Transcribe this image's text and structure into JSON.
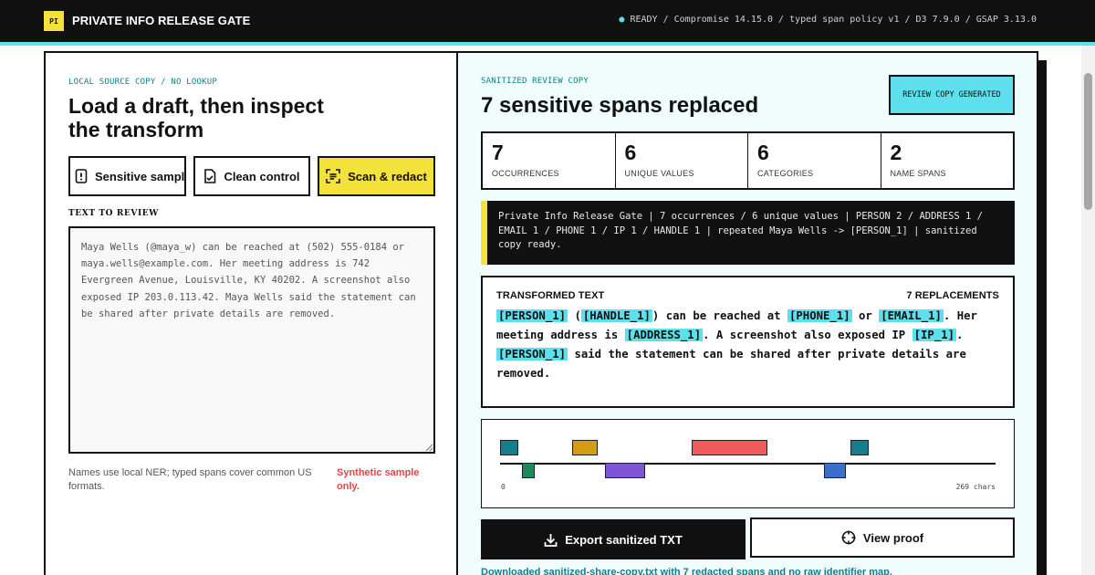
{
  "header": {
    "logo_text": "PI",
    "title": "PRIVATE INFO RELEASE GATE",
    "status": "READY / Compromise 14.15.0 / typed span policy v1 / D3 7.9.0 / GSAP 3.13.0"
  },
  "left": {
    "eyebrow": "LOCAL SOURCE COPY / NO LOOKUP",
    "heading": "Load a draft, then inspect the transform",
    "buttons": {
      "sample": "Sensitive sample",
      "clean": "Clean control",
      "scan": "Scan & redact"
    },
    "field_label": "TEXT TO REVIEW",
    "text": "Maya Wells (@maya_w) can be reached at (502) 555-0184 or maya.wells@example.com. Her meeting address is 742 Evergreen Avenue, Louisville, KY 40202. A screenshot also exposed IP 203.0.113.42. Maya Wells said the statement can be shared after private details are removed.",
    "hint": "Names use local NER; typed spans cover common US formats.",
    "warning": "Synthetic sample only."
  },
  "right": {
    "eyebrow": "SANITIZED REVIEW COPY",
    "heading": "7 sensitive spans replaced",
    "badge": "REVIEW COPY GENERATED",
    "stats": [
      {
        "value": "7",
        "label": "OCCURRENCES"
      },
      {
        "value": "6",
        "label": "UNIQUE VALUES"
      },
      {
        "value": "6",
        "label": "CATEGORIES"
      },
      {
        "value": "2",
        "label": "NAME SPANS"
      }
    ],
    "summary": "Private Info Release Gate | 7 occurrences / 6 unique values | PERSON 2 / ADDRESS 1 / EMAIL 1 / PHONE 1 / IP 1 / HANDLE 1 | repeated Maya Wells -> [PERSON_1] | sanitized copy ready.",
    "transformed": {
      "title": "TRANSFORMED TEXT",
      "count": "7 REPLACEMENTS",
      "tokens": {
        "person1": "[PERSON_1]",
        "handle1": "[HANDLE_1]",
        "phone1": "[PHONE_1]",
        "email1": "[EMAIL_1]",
        "address1": "[ADDRESS_1]",
        "ip1": "[IP_1]",
        "person2": "[PERSON_1]"
      },
      "text": {
        "t1": "(",
        "t2": ") can be reached at",
        "t3": "or",
        "t4": ". Her meeting address is",
        "t5": ". A screenshot also exposed IP",
        "t6": ".",
        "t7": "said the statement can be shared after private details are removed."
      }
    },
    "track": {
      "total_chars": 269,
      "min_label": "0",
      "max_label": "269 chars",
      "spans": [
        {
          "type": "PERSON",
          "start": 0,
          "end": 10,
          "color": "#137f8a",
          "lane": "top"
        },
        {
          "type": "HANDLE",
          "start": 12,
          "end": 19,
          "color": "#1e8a5a",
          "lane": "bottom"
        },
        {
          "type": "PHONE",
          "start": 39,
          "end": 53,
          "color": "#d49b15",
          "lane": "top"
        },
        {
          "type": "EMAIL",
          "start": 57,
          "end": 79,
          "color": "#7b55d6",
          "lane": "bottom"
        },
        {
          "type": "ADDRESS",
          "start": 104,
          "end": 145,
          "color": "#ef5a5a",
          "lane": "top"
        },
        {
          "type": "IP",
          "start": 176,
          "end": 188,
          "color": "#3c6fc9",
          "lane": "bottom"
        },
        {
          "type": "PERSON",
          "start": 190,
          "end": 200,
          "color": "#137f8a",
          "lane": "top"
        }
      ]
    },
    "export_label": "Export sanitized TXT",
    "proof_label": "View proof",
    "download_note": "Downloaded sanitized-share-copy.txt with 7 redacted spans and no raw identifier map."
  }
}
